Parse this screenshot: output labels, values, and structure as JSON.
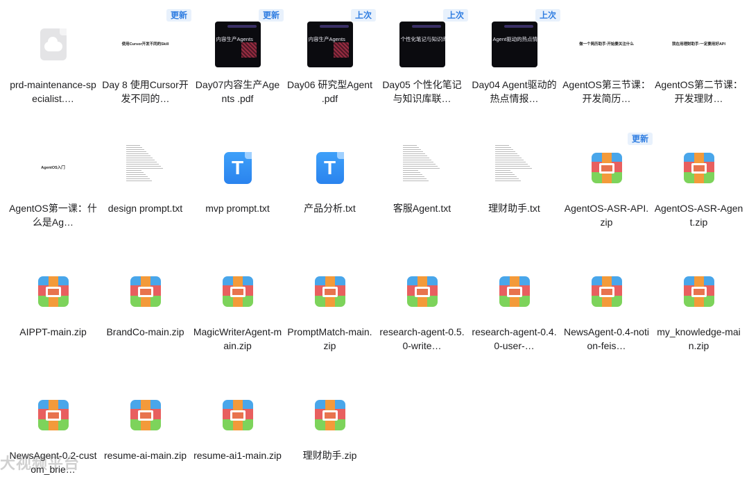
{
  "files": [
    [
      {
        "name": "prd-maintenance-specialist.…",
        "icon": "cloud-file-icon",
        "badge": ""
      },
      {
        "name": "Day 8 使用Cursor开发不同的…",
        "icon": "pdf-slide-icon",
        "badge": "更新",
        "thumb_text": "使用Cursor开发不同的Skill"
      },
      {
        "name": "Day07内容生产Agents .pdf",
        "icon": "pdf-dark-icon",
        "badge": "更新",
        "thumb_text": "内容生产Agents"
      },
      {
        "name": "Day06 研究型Agent .pdf",
        "icon": "pdf-dark-icon",
        "badge": "上次",
        "thumb_text": "内容生产Agents"
      },
      {
        "name": "Day05 个性化笔记与知识库联…",
        "icon": "pdf-dark-icon",
        "badge": "上次",
        "thumb_text": "个性化笔记与知识库联动"
      },
      {
        "name": "Day04 Agent驱动的热点情报…",
        "icon": "pdf-dark-icon",
        "badge": "上次",
        "thumb_text": "Agent驱动的热点情报系"
      },
      {
        "name": "AgentOS第三节课：开发简历…",
        "icon": "pdf-slide-icon",
        "badge": "",
        "thumb_text": "做一个简历助手·开始要关注什么"
      },
      {
        "name": "AgentOS第二节课：开发理财…",
        "icon": "pdf-slide-icon",
        "badge": "",
        "thumb_text": "我在用理财助手·一定要用好API"
      }
    ],
    [
      {
        "name": "AgentOS第一课：什么是Ag…",
        "icon": "pdf-slide-icon",
        "badge": "",
        "thumb_text": "AgentOS入门"
      },
      {
        "name": "design prompt.txt",
        "icon": "txt-doc-icon",
        "badge": ""
      },
      {
        "name": "mvp prompt.txt",
        "icon": "text-file-icon",
        "badge": "",
        "glyph": "T"
      },
      {
        "name": "产品分析.txt",
        "icon": "text-file-icon",
        "badge": "",
        "glyph": "T"
      },
      {
        "name": "客服Agent.txt",
        "icon": "txt-doc-icon",
        "badge": ""
      },
      {
        "name": "理财助手.txt",
        "icon": "txt-doc-icon",
        "badge": ""
      },
      {
        "name": "AgentOS-ASR-API.zip",
        "icon": "zip-archive-icon",
        "badge": "更新"
      },
      {
        "name": "AgentOS-ASR-Agent.zip",
        "icon": "zip-archive-icon",
        "badge": ""
      }
    ],
    [
      {
        "name": "AIPPT-main.zip",
        "icon": "zip-archive-icon",
        "badge": ""
      },
      {
        "name": "BrandCo-main.zip",
        "icon": "zip-archive-icon",
        "badge": ""
      },
      {
        "name": "MagicWriterAgent-main.zip",
        "icon": "zip-archive-icon",
        "badge": ""
      },
      {
        "name": "PromptMatch-main.zip",
        "icon": "zip-archive-icon",
        "badge": ""
      },
      {
        "name": "research-agent-0.5.0-write…",
        "icon": "zip-archive-icon",
        "badge": ""
      },
      {
        "name": "research-agent-0.4.0-user-…",
        "icon": "zip-archive-icon",
        "badge": ""
      },
      {
        "name": "NewsAgent-0.4-notion-feis…",
        "icon": "zip-archive-icon",
        "badge": ""
      },
      {
        "name": "my_knowledge-main.zip",
        "icon": "zip-archive-icon",
        "badge": ""
      }
    ],
    [
      {
        "name": "NewsAgent-0.2-custom_brie…",
        "icon": "zip-archive-icon",
        "badge": ""
      },
      {
        "name": "resume-ai-main.zip",
        "icon": "zip-archive-icon",
        "badge": ""
      },
      {
        "name": "resume-ai1-main.zip",
        "icon": "zip-archive-icon",
        "badge": ""
      },
      {
        "name": "理财助手.zip",
        "icon": "zip-archive-icon",
        "badge": ""
      }
    ]
  ],
  "watermark": "大视频平台",
  "colors": {
    "badge_text": "#2f7de1",
    "badge_bg": "#e8f1fc",
    "zip_blue": "#49a6ea",
    "zip_red": "#e85f5f",
    "zip_green": "#7dd35b",
    "txt_blue": "#2a83ee"
  }
}
